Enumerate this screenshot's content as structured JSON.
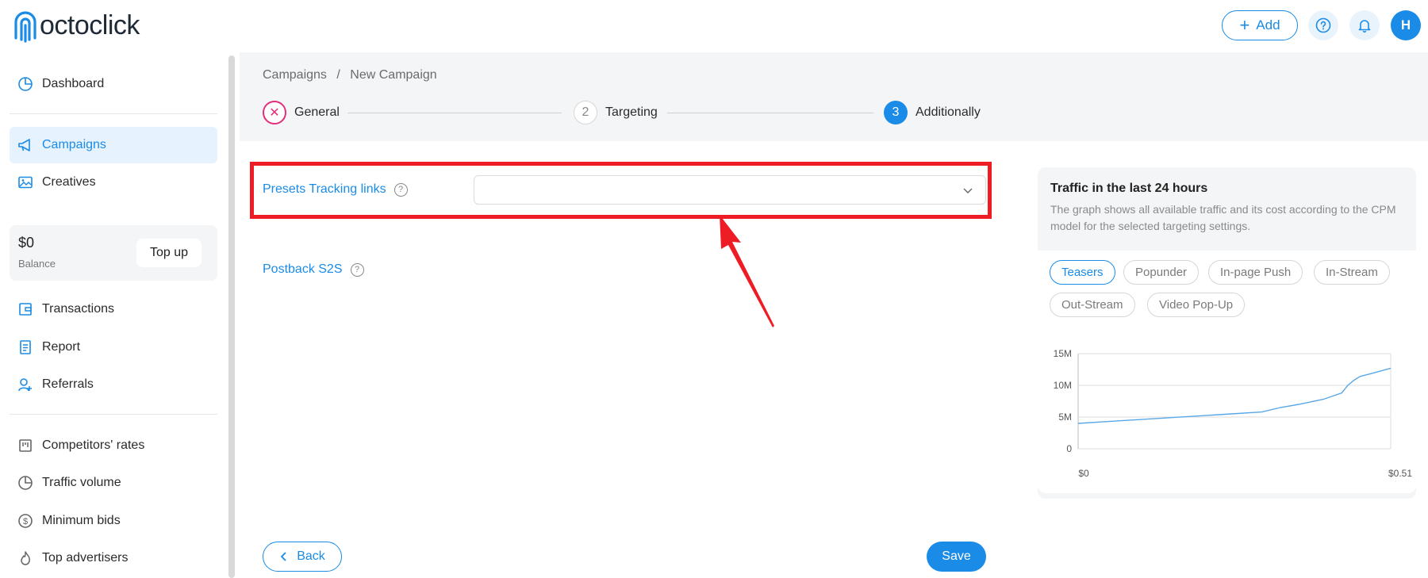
{
  "header": {
    "logo_text": "octoclick",
    "add_label": "Add",
    "avatar_initial": "H"
  },
  "sidebar": {
    "items": [
      {
        "label": "Dashboard",
        "icon": "pie-chart-icon"
      },
      {
        "label": "Campaigns",
        "icon": "megaphone-icon",
        "active": true
      },
      {
        "label": "Creatives",
        "icon": "image-icon"
      },
      {
        "label": "Transactions",
        "icon": "wallet-icon"
      },
      {
        "label": "Report",
        "icon": "report-icon"
      },
      {
        "label": "Referrals",
        "icon": "referrals-icon"
      },
      {
        "label": "Competitors' rates",
        "icon": "board-icon"
      },
      {
        "label": "Traffic volume",
        "icon": "pie-chart-icon"
      },
      {
        "label": "Minimum bids",
        "icon": "dollar-circle-icon"
      },
      {
        "label": "Top advertisers",
        "icon": "flame-icon"
      }
    ],
    "balance": {
      "amount": "$0",
      "label": "Balance",
      "topup_label": "Top up"
    }
  },
  "breadcrumb": {
    "parent": "Campaigns",
    "separator": "/",
    "current": "New Campaign"
  },
  "steps": [
    {
      "label": "General",
      "marker": "✕",
      "state": "error"
    },
    {
      "label": "Targeting",
      "marker": "2",
      "state": "pending"
    },
    {
      "label": "Additionally",
      "marker": "3",
      "state": "active"
    }
  ],
  "form": {
    "presets_label": "Presets Tracking links",
    "presets_value": "",
    "postback_label": "Postback S2S",
    "help_mark": "?"
  },
  "actions": {
    "back_label": "Back",
    "save_label": "Save"
  },
  "traffic": {
    "title": "Traffic in the last 24 hours",
    "description": "The graph shows all available traffic and its cost according to the CPM model for the selected targeting settings.",
    "formats": [
      "Teasers",
      "Popunder",
      "In-page Push",
      "In-Stream",
      "Out-Stream",
      "Video Pop-Up"
    ],
    "active_format": "Teasers"
  },
  "chart_data": {
    "type": "line",
    "x_tick_labels": [
      "$0",
      "$0.51"
    ],
    "y_tick_labels": [
      "15M",
      "10M",
      "5M",
      "0"
    ],
    "ylim": [
      0,
      15000000
    ],
    "xlim": [
      0,
      0.51
    ],
    "grid": true,
    "series": [
      {
        "color": "#5aa8e6",
        "x": [
          0,
          0.05,
          0.1,
          0.15,
          0.2,
          0.25,
          0.3,
          0.33,
          0.36,
          0.4,
          0.43,
          0.44,
          0.45,
          0.46,
          0.48,
          0.51
        ],
        "y": [
          4000000,
          4300000,
          4600000,
          4900000,
          5200000,
          5500000,
          5800000,
          6500000,
          7000000,
          7800000,
          8800000,
          10000000,
          10800000,
          11400000,
          11900000,
          12700000
        ]
      }
    ],
    "accent_color": "#1a8be6"
  }
}
